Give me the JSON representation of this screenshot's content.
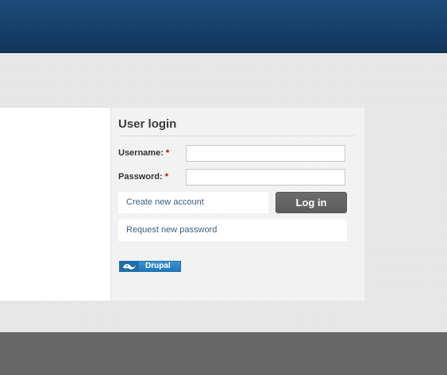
{
  "login_block": {
    "title": "User login",
    "username_label": "Username:",
    "password_label": "Password:",
    "required_marker": "*",
    "username_value": "",
    "password_value": "",
    "create_account_link": "Create new account",
    "login_button": "Log in",
    "request_password_link": "Request new password"
  },
  "powered_by": {
    "badge_text": "Drupal",
    "icon": "drupal-drop-icon"
  },
  "colors": {
    "header": "#17406a",
    "footer": "#676767",
    "button": "#646464",
    "link": "#3b5f86",
    "required": "#cc0000"
  }
}
